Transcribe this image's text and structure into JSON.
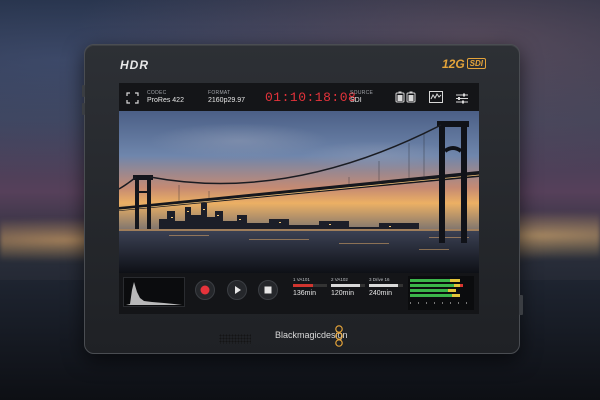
{
  "device": {
    "hdr_logo": "HDR",
    "sdi_logo_main": "12G",
    "sdi_logo_sub": "SDI",
    "brand": "Blackmagicdesign"
  },
  "topbar": {
    "codec_label": "CODEC",
    "codec_value": "ProRes 422",
    "format_label": "FORMAT",
    "format_value": "2160p29.97",
    "timecode": "01:10:18:08",
    "source_label": "SOURCE",
    "source_value": "SDI"
  },
  "disks": [
    {
      "name": "1 VA101",
      "time": "136min",
      "level": 0.6,
      "color": "#d0352f"
    },
    {
      "name": "2 VA102",
      "time": "120min",
      "level": 0.85,
      "color": "#d9d9d9"
    },
    {
      "name": "3 Drive 16",
      "time": "240min",
      "level": 0.85,
      "color": "#d9d9d9"
    }
  ],
  "colors": {
    "timecode": "#e5333b",
    "record": "#e5333b",
    "accent": "#e5a43a"
  },
  "icons": [
    "fullscreen-icon",
    "battery-icon",
    "waveform-icon",
    "settings-sliders-icon",
    "record-icon",
    "play-icon",
    "stop-icon"
  ]
}
